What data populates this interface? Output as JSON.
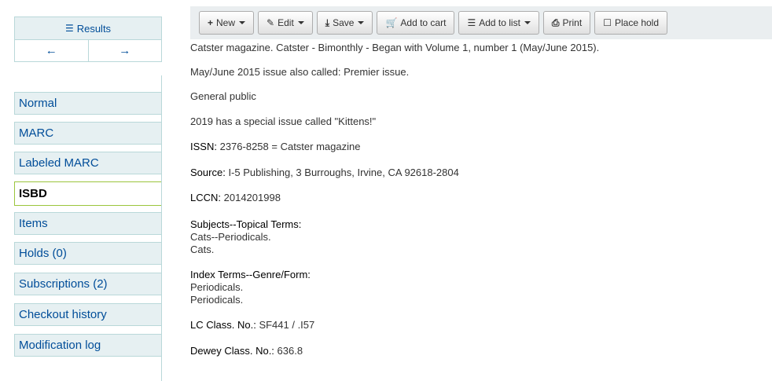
{
  "sidebar": {
    "results_label": "Results",
    "tabs": [
      {
        "label": "Normal"
      },
      {
        "label": "MARC"
      },
      {
        "label": "Labeled MARC"
      },
      {
        "label": "ISBD"
      },
      {
        "label": "Items"
      },
      {
        "label": "Holds (0)"
      },
      {
        "label": "Subscriptions (2)"
      },
      {
        "label": "Checkout history"
      },
      {
        "label": "Modification log"
      }
    ],
    "active_tab": "ISBD"
  },
  "toolbar": {
    "new": "New",
    "edit": "Edit",
    "save": "Save",
    "add_to_cart": "Add to cart",
    "add_to_list": "Add to list",
    "print": "Print",
    "place_hold": "Place hold"
  },
  "record": {
    "series_note": "Catster magazine. Catster - Bimonthly - Began with Volume 1, number 1 (May/June 2015).",
    "issue_note": "May/June 2015 issue also called: Premier issue.",
    "audience": "General public",
    "special_issue": "2019 has a special issue called \"Kittens!\"",
    "issn_label": "ISSN:",
    "issn": "2376-8258 = Catster magazine",
    "source_label": "Source:",
    "source": "I-5 Publishing, 3 Burroughs, Irvine, CA 92618-2804",
    "lccn_label": "LCCN:",
    "lccn": "2014201998",
    "subjects_label": "Subjects--Topical Terms:",
    "subjects": [
      "Cats--Periodicals.",
      "Cats."
    ],
    "genre_label": "Index Terms--Genre/Form:",
    "genre": [
      "Periodicals.",
      "Periodicals."
    ],
    "lc_class_label": "LC Class. No.:",
    "lc_class": "SF441 / .I57",
    "dewey_label": "Dewey Class. No.:",
    "dewey": "636.8"
  },
  "colors": {
    "link": "#004d99",
    "tab_bg": "#e6f0f2",
    "active_border": "#9bc53d",
    "toolbar_bg": "#eaeef0"
  }
}
